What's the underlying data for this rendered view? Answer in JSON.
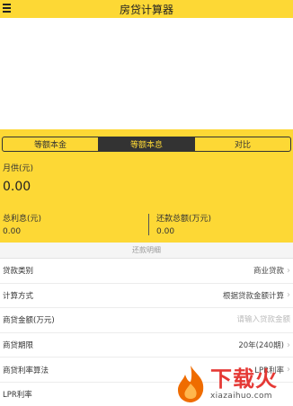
{
  "header": {
    "title": "房贷计算器",
    "menu_icon": "menu-icon"
  },
  "tabs": [
    {
      "label": "等额本金",
      "active": false
    },
    {
      "label": "等额本息",
      "active": true
    },
    {
      "label": "对比",
      "active": false
    }
  ],
  "summary": {
    "monthly_label": "月供(元)",
    "monthly_value": "0.00",
    "interest_label": "总利息(元)",
    "interest_value": "0.00",
    "total_label": "还款总额(万元)",
    "total_value": "0.00"
  },
  "detail_link": "还款明细",
  "form": {
    "loan_type_label": "贷款类别",
    "loan_type_value": "商业贷款",
    "calc_method_label": "计算方式",
    "calc_method_value": "根据贷款金额计算",
    "amount_label": "商贷金额(万元)",
    "amount_placeholder": "请输入贷款金额",
    "term_label": "商贷期限",
    "term_value": "20年(240期)",
    "rate_method_label": "商贷利率算法",
    "rate_method_value": "LPR利率",
    "lpr_label": "LPR利率"
  },
  "watermark": {
    "cn": "下载火",
    "url": "xiazaihuo.com"
  },
  "colors": {
    "accent": "#fdd835",
    "dark": "#333333",
    "brand_red": "#e53935"
  }
}
